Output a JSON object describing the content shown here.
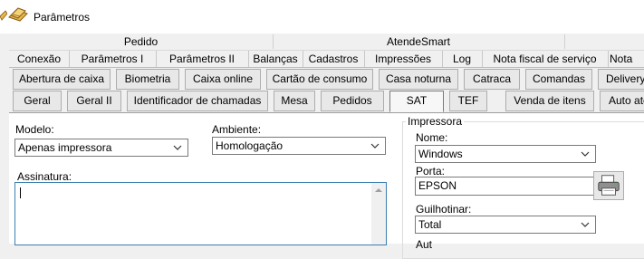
{
  "window": {
    "title": "Parâmetros"
  },
  "tab_groups": {
    "pedido": "Pedido",
    "atendesmart": "AtendeSmart"
  },
  "tabs_row1": [
    "Conexão",
    "Parâmetros I",
    "Parâmetros II",
    "Balanças",
    "Cadastros",
    "Impressões",
    "Log",
    "Nota fiscal de serviço",
    "Nota"
  ],
  "tabs_row2": [
    "Abertura de caixa",
    "Biometria",
    "Caixa online",
    "Cartão de consumo",
    "Casa noturna",
    "Catraca",
    "Comandas",
    "Delivery"
  ],
  "tabs_row3": [
    "Geral",
    "Geral II",
    "Identificador de chamadas",
    "Mesa",
    "Pedidos",
    "SAT",
    "TEF",
    "Venda de itens",
    "Auto aten"
  ],
  "form": {
    "modelo_label": "Modelo:",
    "modelo_value": "Apenas impressora",
    "ambiente_label": "Ambiente:",
    "ambiente_value": "Homologação",
    "assinatura_label": "Assinatura:",
    "assinatura_value": ""
  },
  "impressora": {
    "group_label": "Impressora",
    "nome_label": "Nome:",
    "nome_value": "Windows",
    "porta_label": "Porta:",
    "porta_value": "EPSON",
    "guilhotinar_label": "Guilhotinar:",
    "guilhotinar_value": "Total",
    "next_label": "Aut"
  },
  "colors": {
    "accent_border": "#3c7fb1",
    "window_bg": "#f0f0f0"
  }
}
